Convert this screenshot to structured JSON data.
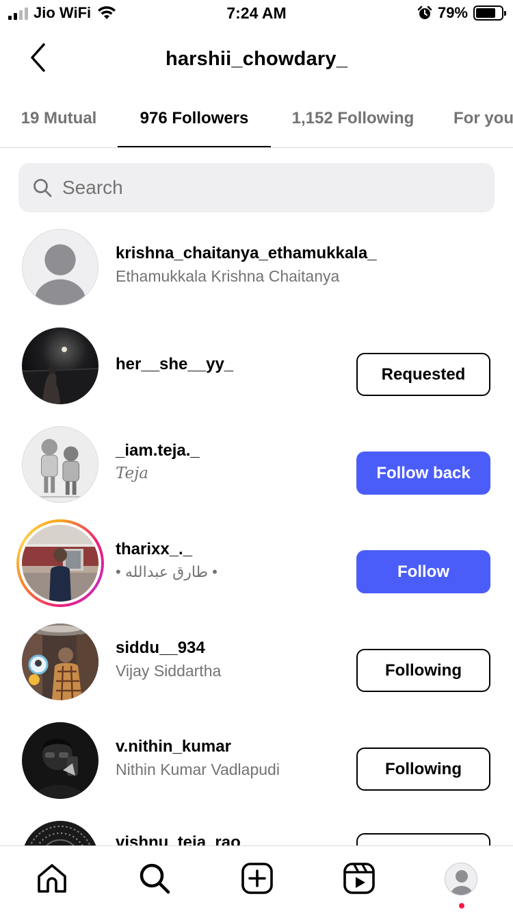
{
  "status_bar": {
    "carrier": "Jio WiFi",
    "time": "7:24 AM",
    "battery_percent": "79%",
    "battery_level": 0.79,
    "signal_bars": 2
  },
  "header": {
    "title": "harshii_chowdary_",
    "back_icon": "chevron-left-icon"
  },
  "tabs": [
    {
      "label": "19 Mutual",
      "active": false
    },
    {
      "label": "976 Followers",
      "active": true
    },
    {
      "label": "1,152 Following",
      "active": false
    },
    {
      "label": "For you",
      "active": false
    }
  ],
  "search": {
    "placeholder": "Search",
    "value": ""
  },
  "followers": [
    {
      "username": "krishna_chaitanya_ethamukkala_",
      "full_name": "Ethamukkala Krishna Chaitanya",
      "button": "",
      "avatar": "default"
    },
    {
      "username": "her__she__yy_",
      "full_name": "",
      "button": "Requested",
      "avatar": "photo"
    },
    {
      "username": "_iam.teja._",
      "full_name": "Teja",
      "button": "Follow back",
      "avatar": "photo"
    },
    {
      "username": "tharixx_._",
      "full_name": "• طارق عبدالله •",
      "button": "Follow",
      "avatar": "photo-story"
    },
    {
      "username": "siddu__934",
      "full_name": "Vijay Siddartha",
      "button": "Following",
      "avatar": "photo"
    },
    {
      "username": "v.nithin_kumar",
      "full_name": "Nithin Kumar Vadlapudi",
      "button": "Following",
      "avatar": "photo"
    },
    {
      "username": "vishnu_teja_rao",
      "full_name": "",
      "button": "",
      "avatar": "photo"
    }
  ],
  "bottom_nav": [
    {
      "icon": "home-icon"
    },
    {
      "icon": "search-icon"
    },
    {
      "icon": "create-icon"
    },
    {
      "icon": "reels-icon"
    },
    {
      "icon": "profile-icon"
    }
  ],
  "colors": {
    "primary_button": "#4a5df9",
    "secondary_text": "#737373",
    "notification_dot": "#ff1744"
  }
}
